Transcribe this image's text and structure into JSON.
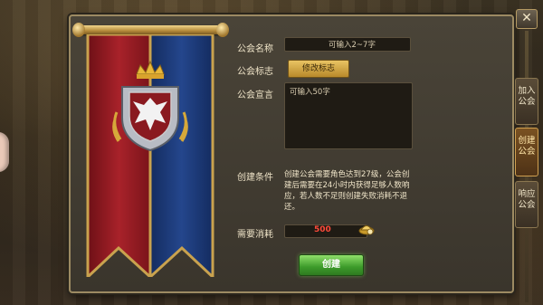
{
  "form": {
    "name_label": "公会名称",
    "name_placeholder": "可输入2~7字",
    "emblem_label": "公会标志",
    "emblem_button": "修改标志",
    "declaration_label": "公会宣言",
    "declaration_placeholder": "可输入50字",
    "conditions_label": "创建条件",
    "conditions_text": "创建公会需要角色达到27级，公会创建后需要在24小时内获得足够人数响应，若人数不足则创建失败消耗不退还。",
    "cost_label": "需要消耗",
    "cost_value": "500",
    "create_button": "创建"
  },
  "side_tabs": [
    {
      "label": "加入公会",
      "active": false
    },
    {
      "label": "创建公会",
      "active": true
    },
    {
      "label": "响应公会",
      "active": false
    }
  ],
  "close_label": "✕",
  "icons": {
    "emblem": "eagle-shield-crown-icon",
    "coin": "gold-ingot-icon",
    "close": "close-icon"
  },
  "colors": {
    "banner_red": "#9a1e24",
    "banner_blue": "#1d3a7a",
    "cost_text": "#ff4a3a",
    "create_button": "#3c9a2a",
    "emblem_button": "#d8ac48"
  }
}
